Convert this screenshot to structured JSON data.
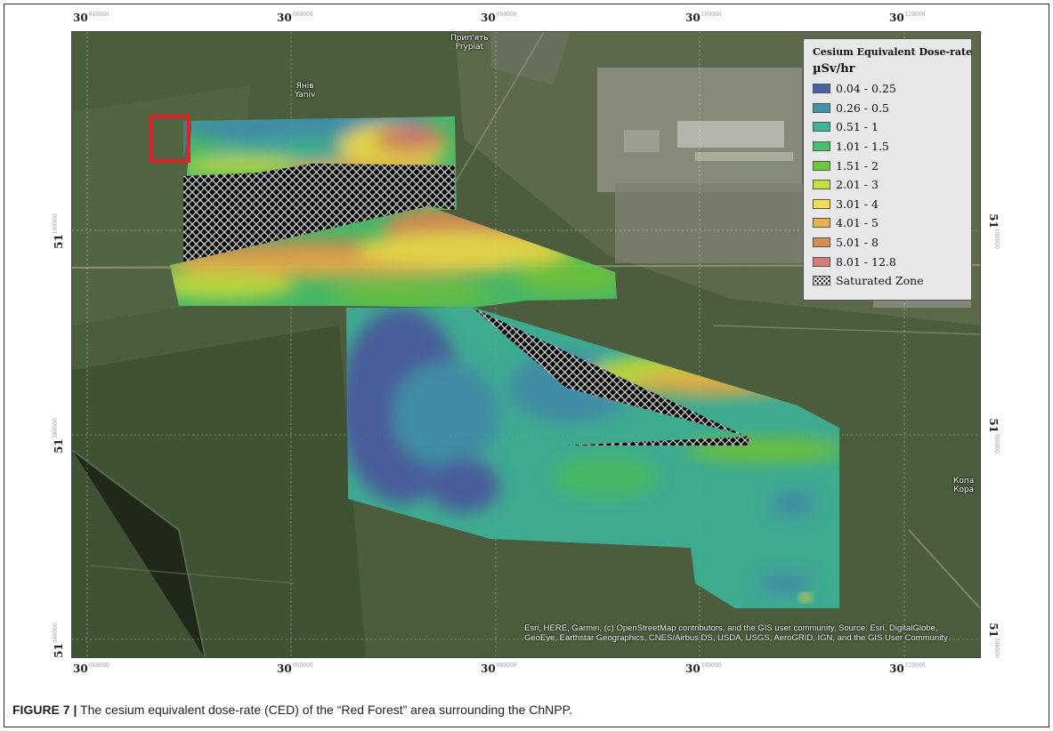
{
  "figure": {
    "label": "FIGURE 7 |",
    "caption": "The cesium equivalent dose-rate (CED) of the “Red Forest” area surrounding the ChNPP."
  },
  "axes": {
    "lon_deg": "30",
    "lon_top": [
      "040000",
      "060000",
      "080000",
      "100000",
      "120000"
    ],
    "lon_bottom": [
      "040000",
      "060000",
      "080000",
      "100000",
      "120000"
    ],
    "lat_deg": "51",
    "lat_left": [
      "190000",
      "380000",
      "340000"
    ],
    "lat_right": [
      "190000",
      "380000",
      "340000"
    ]
  },
  "legend": {
    "title": "Cesium Equivalent Dose-rate",
    "units": "µSv/hr",
    "classes": [
      {
        "label": "0.04 - 0.25",
        "color": "#4a5fa6"
      },
      {
        "label": "0.26 - 0.5",
        "color": "#3f93b1"
      },
      {
        "label": "0.51 - 1",
        "color": "#3db39a"
      },
      {
        "label": "1.01 - 1.5",
        "color": "#47c06a"
      },
      {
        "label": "1.51 - 2",
        "color": "#6dc93c"
      },
      {
        "label": "2.01 - 3",
        "color": "#c4e03c"
      },
      {
        "label": "3.01 - 4",
        "color": "#f0df4a"
      },
      {
        "label": "4.01 - 5",
        "color": "#e9b14a"
      },
      {
        "label": "5.01 - 8",
        "color": "#d98c55"
      },
      {
        "label": "8.01 - 12.8",
        "color": "#d47b78"
      }
    ],
    "saturated_label": "Saturated Zone"
  },
  "places": {
    "pripyat_cyr": "Прип'ять",
    "pripyat_lat": "Prypiat",
    "yaniv_cyr": "Янів",
    "yaniv_lat": "Yaniv",
    "kop_cyr": "Копа",
    "kop_lat": "Кора"
  },
  "attribution": "Esri, HERE, Garmin, (c) OpenStreetMap contributors, and the GIS user community, Source: Esri, DigitalGlobe, GeoEye, Earthstar Geographics, CNES/Airbus DS, USDA, USGS, AeroGRID, IGN, and the GIS User Community",
  "colors": {
    "highlight_box": "#e0202a",
    "imagery_forest": "#4b5d3c",
    "imagery_urban": "#8d8f80"
  }
}
